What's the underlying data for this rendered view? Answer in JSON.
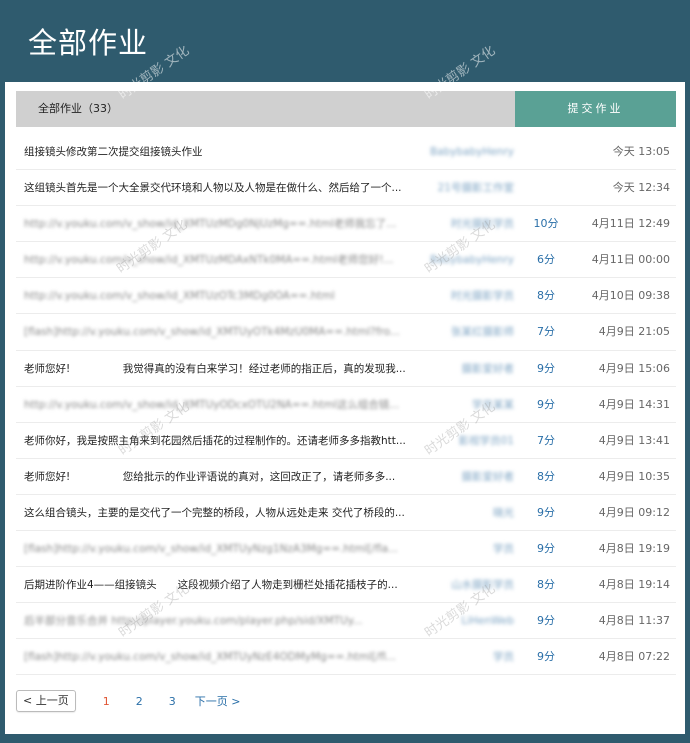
{
  "page_title": "全部作业",
  "tabs": {
    "all_label": "全部作业（33）",
    "submit_label": "提交作业"
  },
  "rows": [
    {
      "title": "组接镜头修改第二次提交组接镜头作业",
      "title_blurred": false,
      "author": "BabybabyHenry",
      "score": "",
      "time": "今天 13:05"
    },
    {
      "title": "这组镜头首先是一个大全景交代环境和人物以及人物是在做什么、然后给了一个...",
      "title_blurred": false,
      "author": "21号摄影工作室",
      "score": "",
      "time": "今天 12:34"
    },
    {
      "title": "http://v.youku.com/v_show/id_XMTUzMDg0NjUzMg==.html老师我忘了...",
      "title_blurred": true,
      "author": "时光摄影学员",
      "score": "10分",
      "time": "4月11日 12:49"
    },
    {
      "title": "http://v.youku.com/v_show/id_XMTUzMDAxNTk0MA==.html老师您好!...",
      "title_blurred": true,
      "author": "BabybabyHenry",
      "score": "6分",
      "time": "4月11日 00:00"
    },
    {
      "title": "http://v.youku.com/v_show/id_XMTUzOTc3MDg0OA==.html",
      "title_blurred": true,
      "author": "时光摄影学员",
      "score": "8分",
      "time": "4月10日 09:38"
    },
    {
      "title": "[flash]http://v.youku.com/v_show/id_XMTUyOTk4MzU0MA==.html?fro...",
      "title_blurred": true,
      "author": "张某红摄影师",
      "score": "7分",
      "time": "4月9日 21:05"
    },
    {
      "title": "老师您好!　　　　　我觉得真的没有白来学习！经过老师的指正后，真的发现我...",
      "title_blurred": false,
      "author": "摄影爱好者",
      "score": "9分",
      "time": "4月9日 15:06"
    },
    {
      "title": "http://v.youku.com/v_show/id_XMTUyODcxOTU2NA==.html这么组合镜...",
      "title_blurred": true,
      "author": "学员某某",
      "score": "9分",
      "time": "4月9日 14:31"
    },
    {
      "title": "老师你好，我是按照主角来到花园然后插花的过程制作的。还请老师多多指教htt...",
      "title_blurred": false,
      "author": "影视学员01",
      "score": "7分",
      "time": "4月9日 13:41"
    },
    {
      "title": "老师您好!　　　　　您给批示的作业评语说的真对，这回改正了，请老师多多...",
      "title_blurred": false,
      "author": "摄影爱好者",
      "score": "8分",
      "time": "4月9日 10:35"
    },
    {
      "title": "这么组合镜头，主要的是交代了一个完整的桥段，人物从远处走来 交代了桥段的...",
      "title_blurred": false,
      "author": "晓光",
      "score": "9分",
      "time": "4月9日 09:12"
    },
    {
      "title": "[flash]http://v.youku.com/v_show/id_XMTUyNzg1NzA3Mg==.html[/fla...",
      "title_blurred": true,
      "author": "学员",
      "score": "9分",
      "time": "4月8日 19:19"
    },
    {
      "title": "后期进阶作业4——组接镜头　　这段视频介绍了人物走到栅栏处插花插枝子的...",
      "title_blurred": false,
      "author": "山水摄影学员",
      "score": "8分",
      "time": "4月8日 19:14"
    },
    {
      "title": "后半部分音乐合并 http://player.youku.com/player.php/sid/XMTUy...",
      "title_blurred": true,
      "author": "LiHenWeb",
      "score": "9分",
      "time": "4月8日 11:37"
    },
    {
      "title": "[flash]http://v.youku.com/v_show/id_XMTUyNzE4ODMyMg==.html[/fl...",
      "title_blurred": true,
      "author": "学员",
      "score": "9分",
      "time": "4月8日 07:22"
    }
  ],
  "pagination": {
    "prev_label": "< 上一页",
    "pages": [
      "1",
      "2",
      "3"
    ],
    "current": "1",
    "next_label": "下一页 >"
  },
  "watermark_text": "时光剪影 文化",
  "colors": {
    "background": "#2f5b6e",
    "submit_button": "#5aa195",
    "link_blue": "#2a6fa8",
    "current_page": "#e05533"
  }
}
